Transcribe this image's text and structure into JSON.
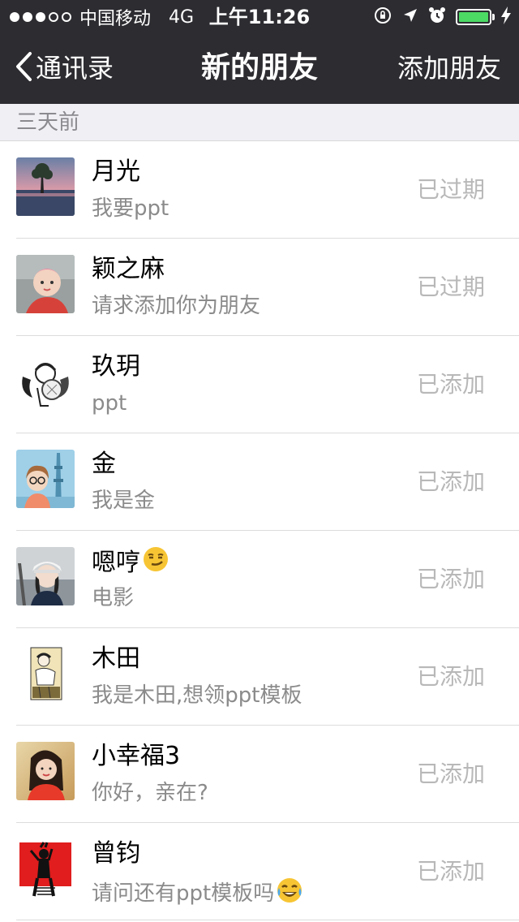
{
  "status_bar": {
    "carrier": "中国移动",
    "network": "4G",
    "time": "上午11:26",
    "battery_color": "#4cd964"
  },
  "nav": {
    "back_label": "通讯录",
    "title": "新的朋友",
    "action_label": "添加朋友"
  },
  "section": {
    "header": "三天前"
  },
  "requests": [
    {
      "name": "月光",
      "message": "我要ppt",
      "status": "已过期",
      "avatar": "landscape-tree"
    },
    {
      "name": "颖之麻",
      "message": "请求添加你为朋友",
      "status": "已过期",
      "avatar": "baby-photo"
    },
    {
      "name": "玖玥",
      "message": "ppt",
      "status": "已添加",
      "avatar": "anime-sketch"
    },
    {
      "name": "金",
      "message": "我是金",
      "status": "已添加",
      "avatar": "cartoon-girl-tower"
    },
    {
      "name": "嗯哼",
      "message": "电影",
      "status": "已添加",
      "avatar": "girl-cap-photo",
      "name_emoji": "smirk-emoji"
    },
    {
      "name": "木田",
      "message": "我是木田,想领ppt模板",
      "status": "已添加",
      "avatar": "manga-panel"
    },
    {
      "name": "小幸福3",
      "message": "你好，亲在?",
      "status": "已添加",
      "avatar": "girl-portrait"
    },
    {
      "name": "曾钧",
      "message": "请问还有ppt模板吗",
      "status": "已添加",
      "avatar": "red-silhouette",
      "message_emoji": "tears-of-joy-emoji"
    }
  ]
}
